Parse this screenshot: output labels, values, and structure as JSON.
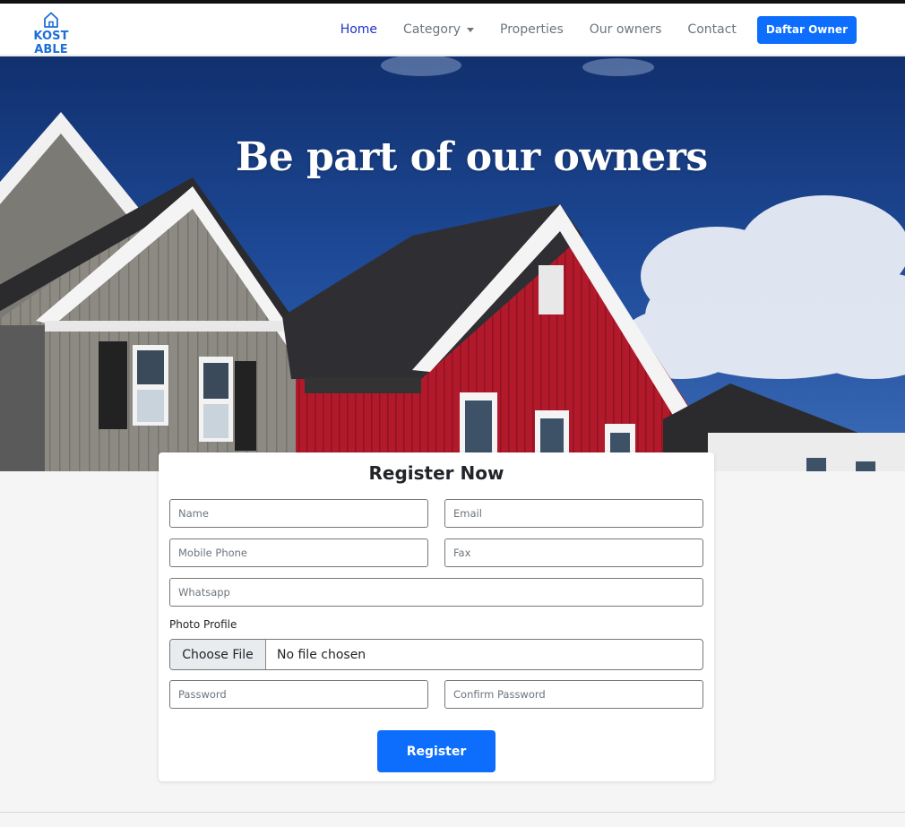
{
  "brand": {
    "name": "KOST ABLE",
    "icon": "house-icon",
    "color": "#1d6fd6"
  },
  "nav": {
    "items": [
      {
        "label": "Home",
        "active": true
      },
      {
        "label": "Category",
        "dropdown": true
      },
      {
        "label": "Properties"
      },
      {
        "label": "Our owners"
      },
      {
        "label": "Contact"
      }
    ],
    "cta_label": "Daftar Owner"
  },
  "hero": {
    "title": "Be part of our owners"
  },
  "form": {
    "title": "Register Now",
    "placeholders": {
      "name": "Name",
      "email": "Email",
      "mobile": "Mobile Phone",
      "fax": "Fax",
      "whatsapp": "Whatsapp",
      "password": "Password",
      "confirm_password": "Confirm Password"
    },
    "photo_label": "Photo Profile",
    "file_button": "Choose File",
    "file_status": "No file chosen",
    "submit_label": "Register"
  },
  "colors": {
    "primary": "#0d6efd",
    "active_link": "#1a34c4",
    "muted_link": "#6c757d"
  }
}
